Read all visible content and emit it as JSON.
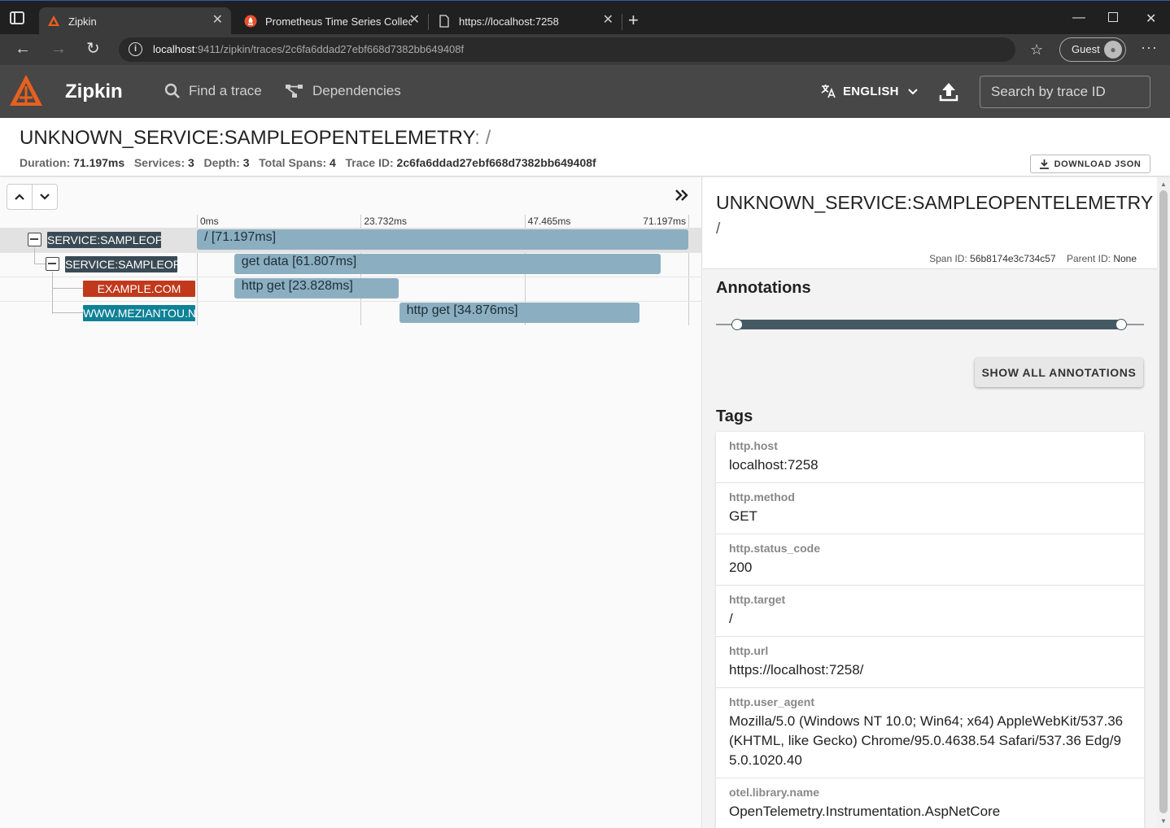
{
  "browser": {
    "tabs": [
      {
        "title": "Zipkin",
        "active": true
      },
      {
        "title": "Prometheus Time Series Collection",
        "active": false
      },
      {
        "title": "https://localhost:7258",
        "active": false
      }
    ],
    "url_host": "localhost",
    "url_rest": ":9411/zipkin/traces/2c6fa6ddad27ebf668d7382bb649408f",
    "guest_label": "Guest"
  },
  "header": {
    "brand": "Zipkin",
    "find_trace": "Find a trace",
    "dependencies": "Dependencies",
    "language": "ENGLISH",
    "search_placeholder": "Search by trace ID"
  },
  "trace": {
    "service": "UNKNOWN_SERVICE:SAMPLEOPENTELEMETRY",
    "separator": ":",
    "span": "/",
    "duration_label": "Duration:",
    "duration": "71.197ms",
    "services_label": "Services:",
    "services": "3",
    "depth_label": "Depth:",
    "depth": "3",
    "spans_label": "Total Spans:",
    "spans": "4",
    "traceid_label": "Trace ID:",
    "trace_id": "2c6fa6ddad27ebf668d7382bb649408f",
    "download_label": "DOWNLOAD JSON"
  },
  "timeline": {
    "ticks": [
      "0ms",
      "23.732ms",
      "47.465ms",
      "71.197ms"
    ],
    "total_ms": 71.197,
    "spans": [
      {
        "service": "UNKNOWN_SERVICE:SAMPLEOPENTELEMETRY",
        "service_visible": "SERVICE:SAMPLEOPEI",
        "label": "/ [71.197ms]",
        "start_ms": 0,
        "duration_ms": 71.197,
        "depth": 0,
        "color": "#3a4a54"
      },
      {
        "service": "UNKNOWN_SERVICE:SAMPLEOPENTELEMETRY",
        "service_visible": "SERVICE:SAMPLEOPEI",
        "label": "get data [61.807ms]",
        "start_ms": 5.4,
        "duration_ms": 61.807,
        "depth": 1,
        "color": "#3a4a54"
      },
      {
        "service": "EXAMPLE.COM",
        "service_visible": "EXAMPLE.COM",
        "label": "http get [23.828ms]",
        "start_ms": 5.4,
        "duration_ms": 23.828,
        "depth": 2,
        "color": "#c1391b"
      },
      {
        "service": "WWW.MEZIANTOU.NET",
        "service_visible": "WWW.MEZIANTOU.NE",
        "label": "http get [34.876ms]",
        "start_ms": 29.3,
        "duration_ms": 34.876,
        "depth": 2,
        "color": "#0f8196"
      }
    ]
  },
  "detail": {
    "service": "UNKNOWN_SERVICE:SAMPLEOPENTELEMETRY",
    "span_name": "/",
    "span_id_label": "Span ID:",
    "span_id": "56b8174e3c734c57",
    "parent_id_label": "Parent ID:",
    "parent_id": "None",
    "annotations_title": "Annotations",
    "show_all": "SHOW ALL ANNOTATIONS",
    "tags_title": "Tags",
    "tags": [
      {
        "key": "http.host",
        "value": "localhost:7258"
      },
      {
        "key": "http.method",
        "value": "GET"
      },
      {
        "key": "http.status_code",
        "value": "200"
      },
      {
        "key": "http.target",
        "value": "/"
      },
      {
        "key": "http.url",
        "value": "https://localhost:7258/"
      },
      {
        "key": "http.user_agent",
        "value": "Mozilla/5.0 (Windows NT 10.0; Win64; x64) AppleWebKit/537.36 (KHTML, like Gecko) Chrome/95.0.4638.54 Safari/537.36 Edg/95.0.1020.40"
      },
      {
        "key": "otel.library.name",
        "value": "OpenTelemetry.Instrumentation.AspNetCore"
      }
    ]
  },
  "colors": {
    "zipkin_orange": "#e8601d",
    "bar": "#8bafc1",
    "header_bg": "#474747"
  }
}
